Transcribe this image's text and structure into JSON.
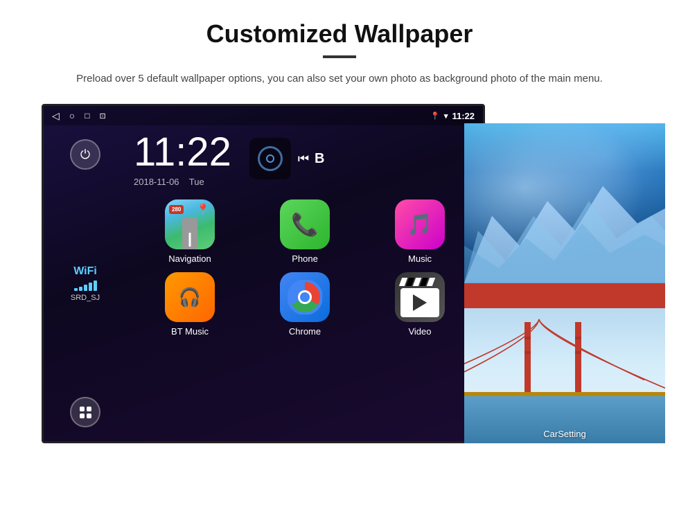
{
  "page": {
    "title": "Customized Wallpaper",
    "subtitle": "Preload over 5 default wallpaper options, you can also set your own photo as background photo of the main menu."
  },
  "status_bar": {
    "time": "11:22",
    "wifi_icon": "wifi",
    "location_icon": "location",
    "signal_icon": "signal"
  },
  "clock": {
    "time": "11:22",
    "date": "2018-11-06",
    "day": "Tue"
  },
  "wifi": {
    "label": "WiFi",
    "ssid": "SRD_SJ",
    "bars": [
      4,
      6,
      9,
      12,
      15
    ]
  },
  "apps": [
    {
      "id": "navigation",
      "label": "Navigation",
      "type": "nav"
    },
    {
      "id": "phone",
      "label": "Phone",
      "type": "phone"
    },
    {
      "id": "music",
      "label": "Music",
      "type": "music"
    },
    {
      "id": "bt-music",
      "label": "BT Music",
      "type": "bt"
    },
    {
      "id": "chrome",
      "label": "Chrome",
      "type": "chrome"
    },
    {
      "id": "video",
      "label": "Video",
      "type": "video"
    }
  ],
  "wallpaper_panels": {
    "bottom_label": "CarSetting"
  },
  "nav_route": "280",
  "buttons": {
    "power": "⏻",
    "apps": "⊞"
  }
}
